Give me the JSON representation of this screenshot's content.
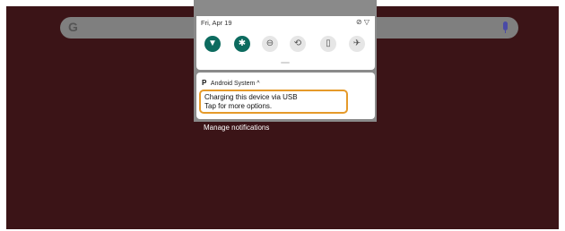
{
  "qs": {
    "date": "Fri, Apr 19",
    "status_icons": "⊘ ▽",
    "tiles": [
      {
        "name": "wifi-icon",
        "glyph": "▼",
        "active": true
      },
      {
        "name": "bluetooth-icon",
        "glyph": "✱",
        "active": true
      },
      {
        "name": "do-not-disturb-icon",
        "glyph": "⊖",
        "active": false
      },
      {
        "name": "auto-rotate-icon",
        "glyph": "⟲",
        "active": false
      },
      {
        "name": "battery-saver-icon",
        "glyph": "▯",
        "active": false
      },
      {
        "name": "airplane-mode-icon",
        "glyph": "✈",
        "active": false
      }
    ]
  },
  "notification": {
    "app_icon": "P",
    "app_name": "Android System",
    "expand_chevron": "^",
    "title": "Charging this device via USB",
    "text": "Tap for more options."
  },
  "footer": {
    "manage_label": "Manage notifications"
  },
  "search": {
    "logo": "G"
  },
  "colors": {
    "wallpaper": "#3b1417",
    "tile_active": "#0d6b5f",
    "highlight": "#e59a2a"
  }
}
